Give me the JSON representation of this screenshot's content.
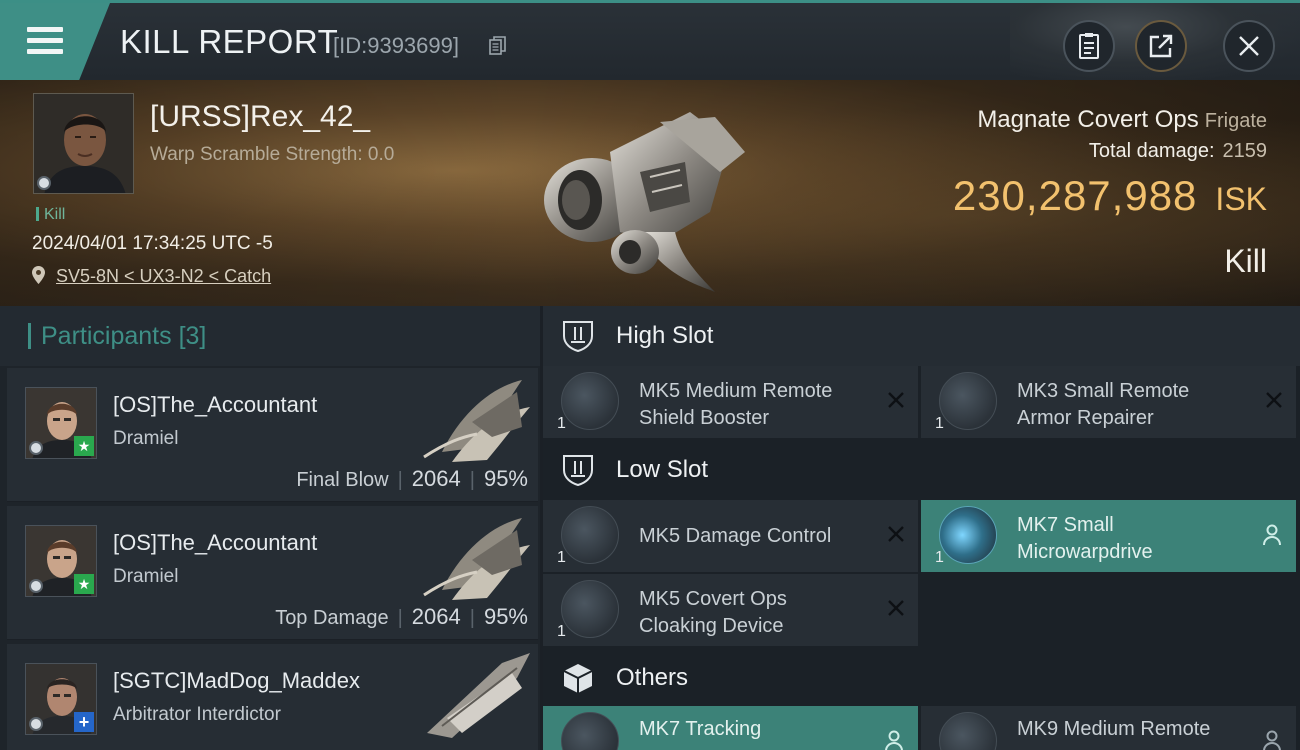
{
  "header": {
    "title": "KILL REPORT",
    "report_id": "[ID:9393699]"
  },
  "victim": {
    "name": "[URSS]Rex_42_",
    "warp_scramble": "Warp Scramble Strength: 0.0",
    "tag": "Kill",
    "datetime": "2024/04/01 17:34:25 UTC -5",
    "location": "SV5-8N < UX3-N2 < Catch",
    "ship_name": "Magnate Covert Ops",
    "ship_class": "Frigate",
    "total_damage_label": "Total damage:",
    "total_damage": "2159",
    "isk_value": "230,287,988",
    "isk_unit": "ISK",
    "result": "Kill"
  },
  "participants": {
    "label": "Participants",
    "count": "[3]",
    "rows": [
      {
        "name": "[OS]The_Accountant",
        "ship": "Dramiel",
        "role": "Final Blow",
        "damage": "2064",
        "percent": "95%"
      },
      {
        "name": "[OS]The_Accountant",
        "ship": "Dramiel",
        "role": "Top Damage",
        "damage": "2064",
        "percent": "95%"
      },
      {
        "name": "[SGTC]MadDog_Maddex",
        "ship": "Arbitrator Interdictor",
        "role": "",
        "damage": "",
        "percent": ""
      }
    ]
  },
  "fitting": {
    "high_label": "High Slot",
    "low_label": "Low Slot",
    "others_label": "Others",
    "high": [
      {
        "line1": "MK5 Medium Remote",
        "line2": "Shield Booster",
        "qty": "1"
      },
      {
        "line1": "MK3 Small Remote",
        "line2": "Armor Repairer",
        "qty": "1"
      }
    ],
    "low": [
      {
        "line1": "MK5 Damage Control",
        "line2": "",
        "qty": "1"
      },
      {
        "line1": "MK7 Small",
        "line2": "Microwarpdrive",
        "qty": "1"
      },
      {
        "line1": "MK5 Covert Ops",
        "line2": "Cloaking Device",
        "qty": "1"
      }
    ],
    "others": [
      {
        "line1": "MK7 Tracking",
        "line2": ""
      },
      {
        "line1": "MK9 Medium Remote",
        "line2": ""
      }
    ]
  },
  "colors": {
    "accent": "#3e8f86",
    "isk": "#f2c16e",
    "active_module": "#3c8278"
  },
  "icons": {
    "menu": "hamburger-menu-icon",
    "copy": "copy-icon",
    "clipboard": "clipboard-icon",
    "share": "share-icon",
    "close": "close-icon",
    "location": "location-pin-icon"
  }
}
